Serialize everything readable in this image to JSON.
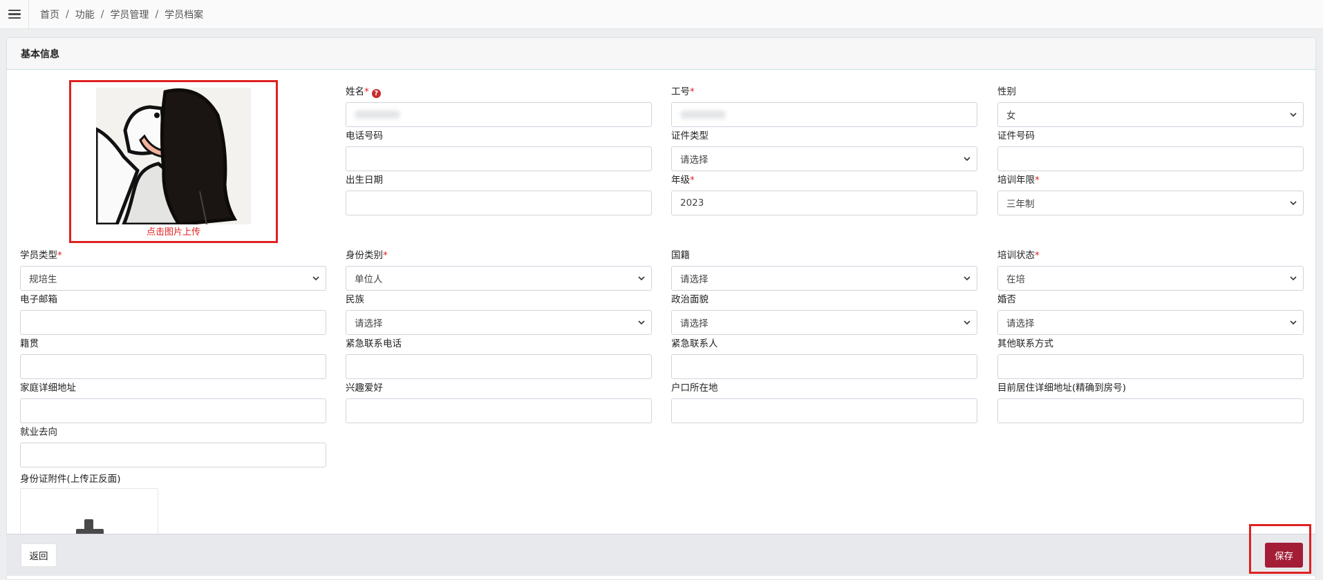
{
  "breadcrumb": {
    "items": [
      "首页",
      "功能",
      "学员管理",
      "学员档案"
    ],
    "separator": "/"
  },
  "card": {
    "title": "基本信息"
  },
  "photo": {
    "caption": "点击图片上传"
  },
  "fields": {
    "name": {
      "label": "姓名",
      "required": "*",
      "value": ""
    },
    "staff_no": {
      "label": "工号",
      "required": "*",
      "value": ""
    },
    "gender": {
      "label": "性别",
      "value": "女"
    },
    "phone": {
      "label": "电话号码",
      "value": ""
    },
    "id_type": {
      "label": "证件类型",
      "value": "请选择"
    },
    "id_no": {
      "label": "证件号码",
      "value": ""
    },
    "birthday": {
      "label": "出生日期",
      "value": ""
    },
    "grade": {
      "label": "年级",
      "required": "*",
      "value": "2023"
    },
    "training_years": {
      "label": "培训年限",
      "required": "*",
      "value": "三年制"
    },
    "student_type": {
      "label": "学员类型",
      "required": "*",
      "value": "规培生"
    },
    "identity": {
      "label": "身份类别",
      "required": "*",
      "value": "单位人"
    },
    "nationality": {
      "label": "国籍",
      "value": "请选择"
    },
    "training_status": {
      "label": "培训状态",
      "required": "*",
      "value": "在培"
    },
    "email": {
      "label": "电子邮箱",
      "value": ""
    },
    "ethnicity": {
      "label": "民族",
      "value": "请选择"
    },
    "politics": {
      "label": "政治面貌",
      "value": "请选择"
    },
    "marital": {
      "label": "婚否",
      "value": "请选择"
    },
    "native_place": {
      "label": "籍贯",
      "value": ""
    },
    "emergency_phone": {
      "label": "紧急联系电话",
      "value": ""
    },
    "emergency_contact": {
      "label": "紧急联系人",
      "value": ""
    },
    "other_contact": {
      "label": "其他联系方式",
      "value": ""
    },
    "home_address": {
      "label": "家庭详细地址",
      "value": ""
    },
    "hobbies": {
      "label": "兴趣爱好",
      "value": ""
    },
    "hukou": {
      "label": "户口所在地",
      "value": ""
    },
    "current_address": {
      "label": "目前居住详细地址(精确到房号)",
      "value": ""
    },
    "employment": {
      "label": "就业去向",
      "value": ""
    }
  },
  "id_attachment": {
    "label": "身份证附件(上传正反面)"
  },
  "footer": {
    "back_label": "返回",
    "save_label": "保存"
  },
  "colors": {
    "required": "#e02020",
    "save_button": "#a31d37",
    "highlight_frame": "#e02020"
  }
}
